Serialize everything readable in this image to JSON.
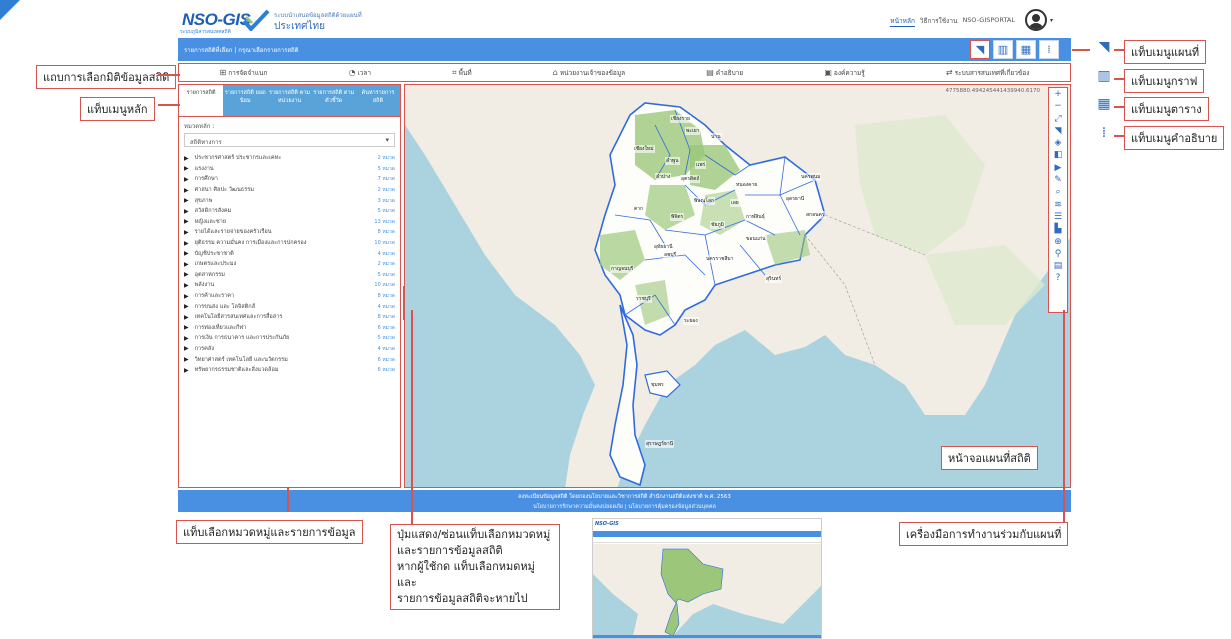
{
  "header": {
    "logo_text": "NSO-GIS",
    "logo_sub": "ระบบภูมิสารสนเทศสถิติ",
    "brand_line1": "ระบบนำเสนอข้อมูลสถิติด้วยแผนที่",
    "brand_line2": "ประเทศไทย",
    "nav": [
      "หน้าหลัก",
      "วิธีการใช้งาน",
      "NSO-GISPORTAL"
    ]
  },
  "blue_bar": {
    "text": "รายการสถิติที่เลือก | กรุณาเลือกรายการสถิติ"
  },
  "filters": [
    {
      "icon": "org-icon",
      "glyph": "⊞",
      "label": "การจัดจำแนก"
    },
    {
      "icon": "clock-icon",
      "glyph": "◔",
      "label": "เวลา"
    },
    {
      "icon": "area-icon",
      "glyph": "⌗",
      "label": "พื้นที่"
    },
    {
      "icon": "building-icon",
      "glyph": "⌂",
      "label": "หน่วยงานเจ้าของข้อมูล"
    },
    {
      "icon": "doc-icon",
      "glyph": "▤",
      "label": "คำอธิบาย"
    },
    {
      "icon": "book-icon",
      "glyph": "▣",
      "label": "องค์ความรู้"
    },
    {
      "icon": "link-icon",
      "glyph": "⇄",
      "label": "ระบบสารสนเทศที่เกี่ยวข้อง"
    }
  ],
  "side_tabs": [
    "รายการสถิติ",
    "รายการสถิติ ยอดนิยม",
    "รายการสถิติ ตามหน่วยงาน",
    "รายการสถิติ ตามตัวชี้วัด",
    "ค้นหารายการ สถิติ"
  ],
  "category": {
    "label": "หมวดหลัก :",
    "selected": "สถิติทางการ",
    "items": [
      {
        "name": "ประชากรศาสตร์ ประชากรและเคหะ",
        "count": "2 หมวด"
      },
      {
        "name": "แรงงาน",
        "count": "5 หมวด"
      },
      {
        "name": "การศึกษา",
        "count": "7 หมวด"
      },
      {
        "name": "ศาสนา ศิลปะ วัฒนธรรม",
        "count": "2 หมวด"
      },
      {
        "name": "สุขภาพ",
        "count": "3 หมวด"
      },
      {
        "name": "สวัสดิการสังคม",
        "count": "5 หมวด"
      },
      {
        "name": "หญิงและชาย",
        "count": "13 หมวด"
      },
      {
        "name": "รายได้และรายจ่ายของครัวเรือน",
        "count": "8 หมวด"
      },
      {
        "name": "ยุติธรรม ความมั่นคง การเมืองและการปกครอง",
        "count": "10 หมวด"
      },
      {
        "name": "บัญชีประชาชาติ",
        "count": "4 หมวด"
      },
      {
        "name": "เกษตรและประมง",
        "count": "2 หมวด"
      },
      {
        "name": "อุตสาหกรรม",
        "count": "5 หมวด"
      },
      {
        "name": "พลังงาน",
        "count": "10 หมวด"
      },
      {
        "name": "การค้าและราคา",
        "count": "8 หมวด"
      },
      {
        "name": "การขนส่ง และ โลจิสติกส์",
        "count": "4 หมวด"
      },
      {
        "name": "เทคโนโลยีสารสนเทศและการสื่อสาร",
        "count": "8 หมวด"
      },
      {
        "name": "การท่องเที่ยวและกีฬา",
        "count": "6 หมวด"
      },
      {
        "name": "การเงิน การธนาคาร และการประกันภัย",
        "count": "5 หมวด"
      },
      {
        "name": "การคลัง",
        "count": "4 หมวด"
      },
      {
        "name": "วิทยาศาสตร์ เทคโนโลยี และนวัตกรรม",
        "count": "6 หมวด"
      },
      {
        "name": "ทรัพยากรธรรมชาติและสิ่งแวดล้อม",
        "count": "6 หมวด"
      }
    ]
  },
  "map": {
    "coords": "4775880.494245441439940.6170",
    "labels": [
      "เชียงราย",
      "พะเยา",
      "น่าน",
      "เชียงใหม่",
      "ลำพูน",
      "แพร่",
      "ลำปาง",
      "อุตรดิตถ์",
      "หนองคาย",
      "เลย",
      "อุดรธานี",
      "สกลนคร",
      "นครพนม",
      "พิษณุโลก",
      "ตาก",
      "กาฬสินธุ์",
      "พิจิตร",
      "ขอนแก่น",
      "ชัยภูมิ",
      "อุทัยธานี",
      "ลพบุรี",
      "นครราชสีมา",
      "สุรินทร์",
      "กาญจนบุรี",
      "ราชบุรี",
      "ระยอง",
      "ชุมพร",
      "สุราษฎร์ธานี"
    ]
  },
  "footer": {
    "line1": "ลงทะเบียนข้อมูลสถิติ โดยกองนโยบายและวิชาการสถิติ สำนักงานสถิติแห่งชาติ พ.ศ. 2563",
    "line2": "นโยบายการรักษาความมั่นคงปลอดภัย | นโยบายการคุ้มครองข้อมูลส่วนบุคคล"
  },
  "callouts": {
    "filter_bar": "แถบการเลือกมิติข้อมูลสถิติ",
    "main_tabs": "แท็บเมนูหลัก",
    "map_menu": "แท็บเมนูแผนที่",
    "graph_menu": "แท็บเมนูกราฟ",
    "table_menu": "แท็บเมนูตาราง",
    "desc_menu": "แท็บเมนูคำอธิบาย",
    "map_screen": "หน้าจอแผนที่สถิติ",
    "category_tab": "แท็บเลือกหมวดหมู่และรายการข้อมูล",
    "toggle_desc": [
      "ปุ่มแสดง/ซ่อนแท็บเลือกหมวดหมู่",
      "และรายการข้อมูลสถิติ",
      "หากผู้ใช้กด แท็บเลือกหมดหมู่และ",
      "รายการข้อมูลสถิติจะหายไป"
    ],
    "map_tools": "เครื่องมือการทำงานร่วมกับแผนที่"
  },
  "colors": {
    "accent": "#4a90e2",
    "callout_border": "#d9534f",
    "land": "#9cc77a",
    "sea": "#aad3df",
    "boundary": "#2f6bdf"
  }
}
